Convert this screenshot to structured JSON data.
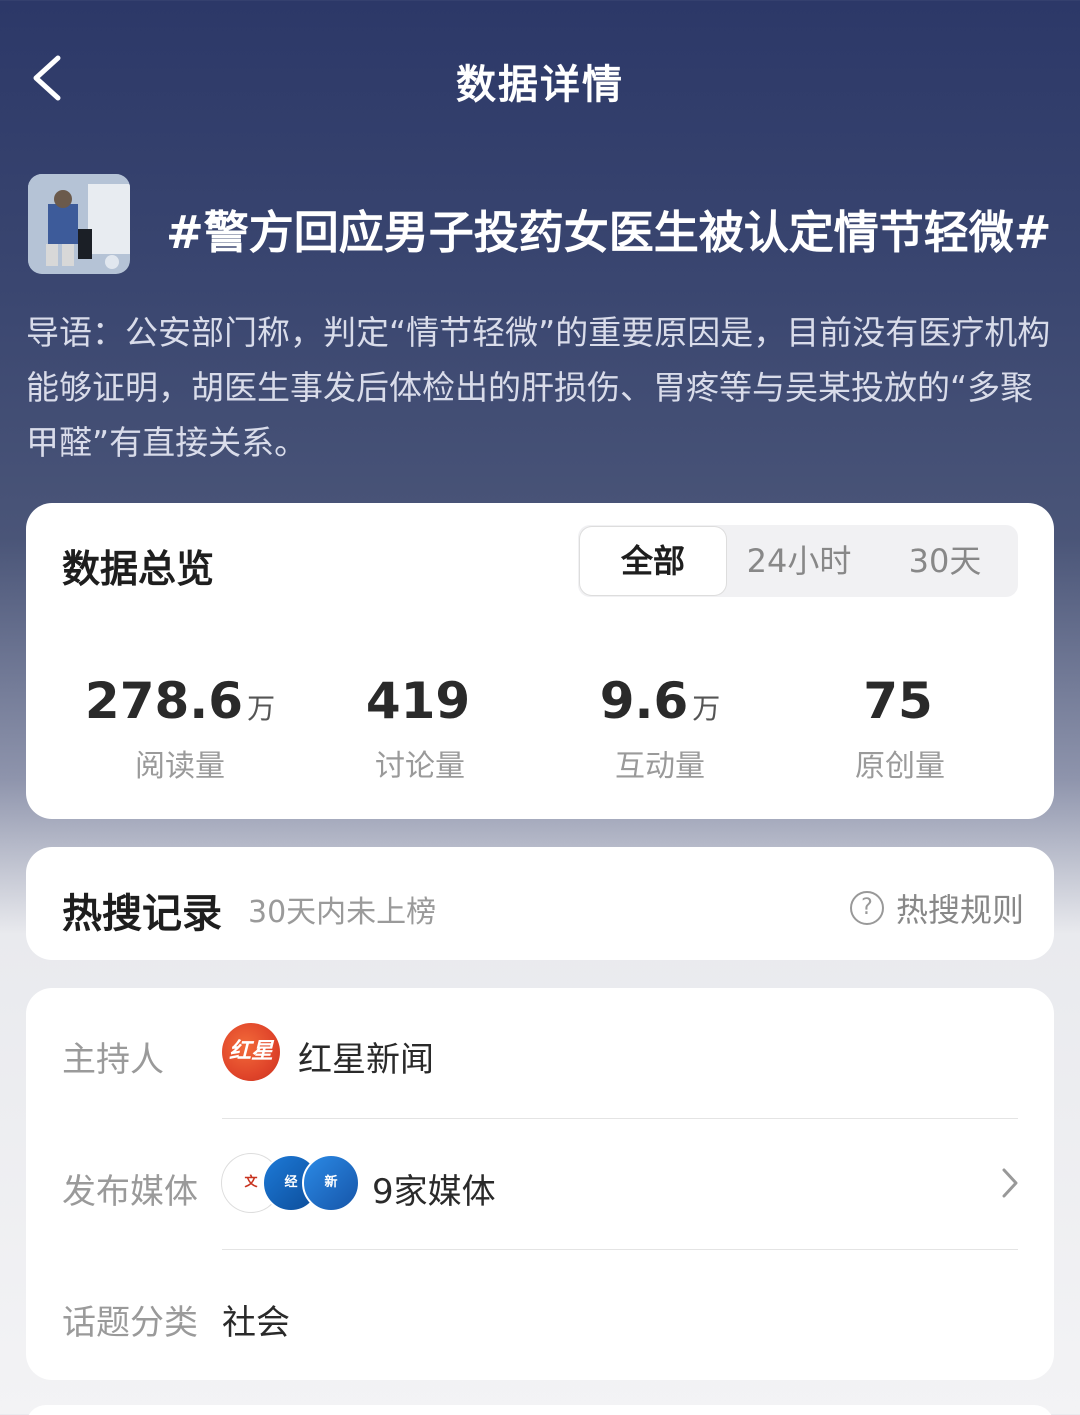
{
  "header": {
    "title": "数据详情",
    "back_icon": "chevron-left-icon"
  },
  "topic": {
    "title": "#警方回应男子投药女医生被认定情节轻微#",
    "intro": "导语：公安部门称，判定“情节轻微”的重要原因是，目前没有医疗机构能够证明，胡医生事发后体检出的肝损伤、胃疼等与吴某投放的“多聚甲醛”有直接关系。"
  },
  "overview": {
    "title": "数据总览",
    "tabs": [
      {
        "label": "全部",
        "active": true
      },
      {
        "label": "24小时",
        "active": false
      },
      {
        "label": "30天",
        "active": false
      }
    ],
    "stats": [
      {
        "value": "278.6",
        "unit": "万",
        "label": "阅读量"
      },
      {
        "value": "419",
        "unit": "",
        "label": "讨论量"
      },
      {
        "value": "9.6",
        "unit": "万",
        "label": "互动量"
      },
      {
        "value": "75",
        "unit": "",
        "label": "原创量"
      }
    ]
  },
  "hot_search": {
    "title": "热搜记录",
    "status": "30天内未上榜",
    "rules_label": "热搜规则"
  },
  "info": {
    "host_label": "主持人",
    "host_name": "红星新闻",
    "host_avatar_text": "红星",
    "media_label": "发布媒体",
    "media_count": "9家媒体",
    "category_label": "话题分类",
    "category_value": "社会"
  },
  "colors": {
    "header_bg": "#2c3868",
    "card_bg": "#ffffff",
    "accent_red": "#e0452a"
  }
}
